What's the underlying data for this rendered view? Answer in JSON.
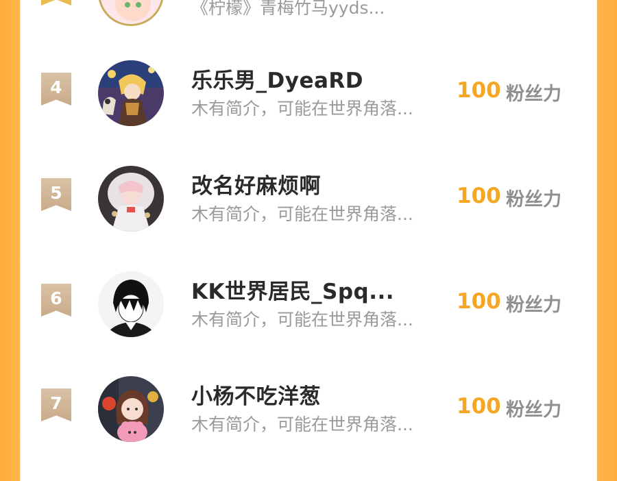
{
  "previous_entry": {
    "bio": "《柠檬》青梅竹马yyds..."
  },
  "entries": [
    {
      "rank": "4",
      "name": "乐乐男_DyeaRD",
      "bio": "木有简介，可能在世界角落...",
      "score": "100",
      "score_unit": "粉丝力"
    },
    {
      "rank": "5",
      "name": "改名好麻烦啊",
      "bio": "木有简介，可能在世界角落...",
      "score": "100",
      "score_unit": "粉丝力"
    },
    {
      "rank": "6",
      "name": "KK世界居民_Spq...",
      "bio": "木有简介，可能在世界角落...",
      "score": "100",
      "score_unit": "粉丝力"
    },
    {
      "rank": "7",
      "name": "小杨不吃洋葱",
      "bio": "木有简介，可能在世界角落...",
      "score": "100",
      "score_unit": "粉丝力"
    }
  ],
  "colors": {
    "side_accent": "#ffad3d",
    "score_color": "#f5a623",
    "badge_color": "#d9c2a6"
  }
}
